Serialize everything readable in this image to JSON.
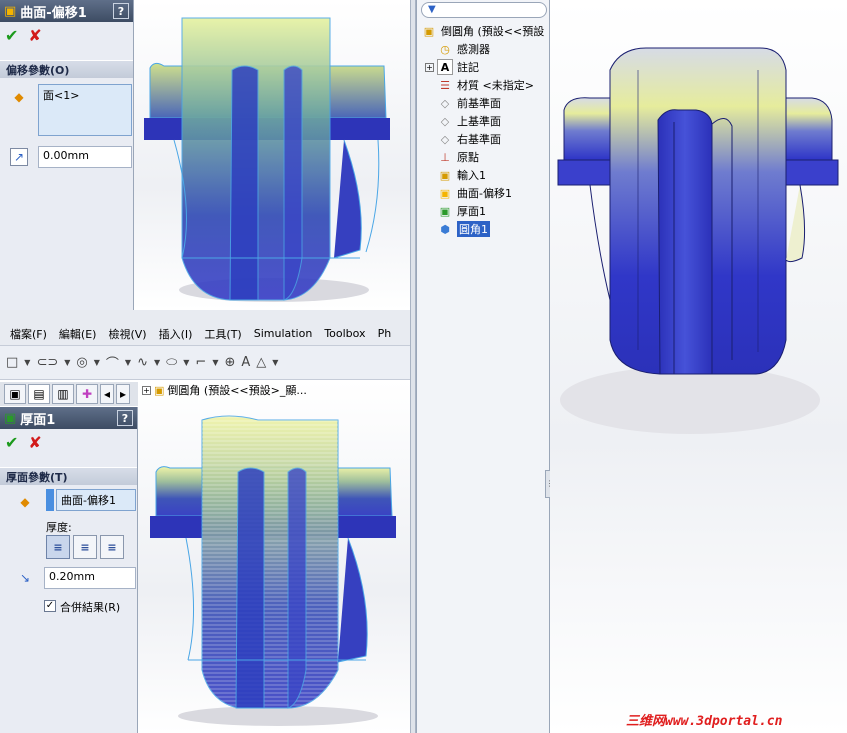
{
  "top_panel": {
    "title": "曲面-偏移1",
    "help": "?",
    "ok": "✔",
    "cancel": "✘",
    "group_title": "偏移參數(O)",
    "face_value": "面<1>",
    "distance_value": "0.00mm"
  },
  "menubar": {
    "items": [
      "檔案(F)",
      "編輯(E)",
      "檢視(V)",
      "插入(I)",
      "工具(T)",
      "Simulation",
      "Toolbox",
      "Ph"
    ]
  },
  "bottom_tree_path": "倒圓角 (預設<<預設>_顯...",
  "bottom_panel": {
    "title": "厚面1",
    "help": "?",
    "ok": "✔",
    "cancel": "✘",
    "group_title": "厚面參數(T)",
    "surface_value": "曲面-偏移1",
    "thickness_label": "厚度:",
    "thickness_value": "0.20mm",
    "merge_label": "合併結果(R)",
    "merge_checked": true
  },
  "feature_tree": {
    "filter_icon": "filter-icon",
    "root": "倒圓角 (預設<<預設",
    "items": [
      {
        "label": "感測器",
        "icon": "sensor-icon"
      },
      {
        "label": "註記",
        "icon": "annotation-icon"
      },
      {
        "label": "材質 <未指定>",
        "icon": "material-icon"
      },
      {
        "label": "前基準面",
        "icon": "plane-icon"
      },
      {
        "label": "上基準面",
        "icon": "plane-icon"
      },
      {
        "label": "右基準面",
        "icon": "plane-icon"
      },
      {
        "label": "原點",
        "icon": "origin-icon"
      },
      {
        "label": "輸入1",
        "icon": "import-icon"
      },
      {
        "label": "曲面-偏移1",
        "icon": "offset-surface-icon"
      },
      {
        "label": "厚面1",
        "icon": "thicken-icon"
      },
      {
        "label": "圓角1",
        "icon": "fillet-icon",
        "selected": true
      }
    ]
  },
  "watermark": "三维网www.3dportal.cn",
  "colors": {
    "accent": "#2d62c6",
    "model_blue": "#2a35b8",
    "model_yellow": "#e8f0a8"
  }
}
